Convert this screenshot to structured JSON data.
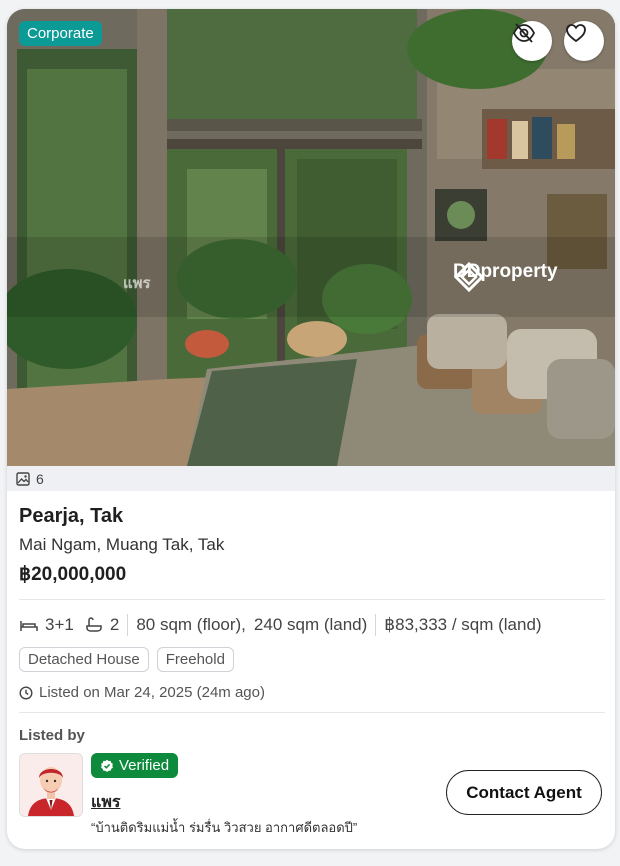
{
  "listing": {
    "badge": "Corporate",
    "photo_count": "6",
    "watermark_brand": "DDproperty",
    "watermark_agent": "แพร",
    "title": "Pearja, Tak",
    "location": "Mai Ngam, Muang Tak, Tak",
    "price": "฿20,000,000",
    "bedrooms": "3+1",
    "bathrooms": "2",
    "floor_area": "80 sqm (floor),",
    "land_area": "240 sqm (land)",
    "price_per_sqm": "฿83,333 / sqm (land)",
    "tags": [
      "Detached House",
      "Freehold"
    ],
    "listed_on": "Listed on Mar 24, 2025 (24m ago)"
  },
  "agent": {
    "section_label": "Listed by",
    "verified_label": "Verified",
    "name": "แพร",
    "quote": "“บ้านติดริมแม่น้ำ ร่มรื่น วิวสวย อากาศดีตลอดปี”",
    "contact_label": "Contact Agent"
  },
  "colors": {
    "corporate_badge": "#0c9a96",
    "verified_badge": "#0d8a3c"
  },
  "icons": [
    "eye-off-icon",
    "heart-icon",
    "image-icon",
    "bed-icon",
    "bath-icon",
    "clock-icon",
    "badge-check-icon",
    "ddproperty-logo"
  ]
}
